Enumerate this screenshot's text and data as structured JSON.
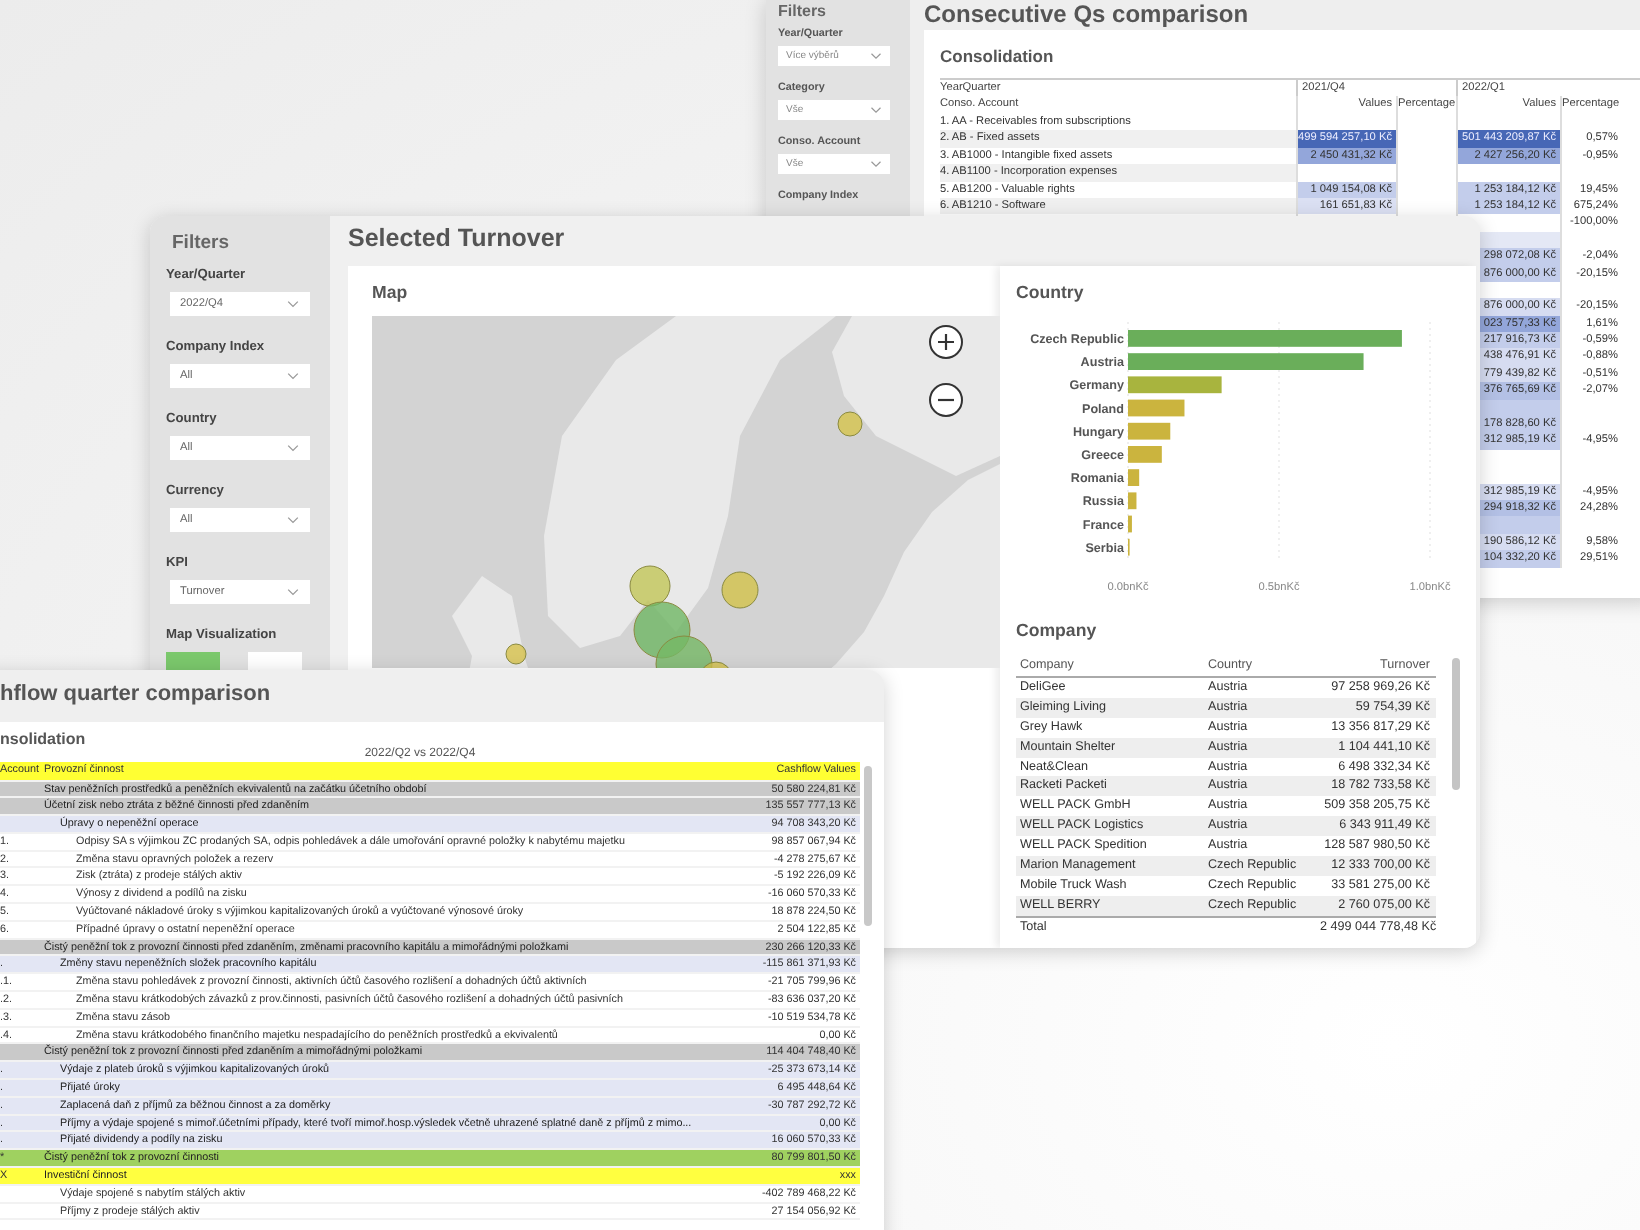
{
  "comparison_window": {
    "filters_title": "Filters",
    "filters": [
      {
        "label": "Year/Quarter",
        "value": "Více výběrů"
      },
      {
        "label": "Category",
        "value": "Vše"
      },
      {
        "label": "Conso. Account",
        "value": "Vše"
      },
      {
        "label": "Company Index"
      }
    ],
    "title": "Consecutive Qs comparison",
    "card_title": "Consolidation",
    "table": {
      "row_header": "YearQuarter",
      "account_header": "Conso. Account",
      "quarters": [
        {
          "label": "2021/Q4",
          "values": "Values",
          "percentage": "Percentage"
        },
        {
          "label": "2022/Q1",
          "values": "Values",
          "percentage": "Percentage"
        }
      ],
      "rows": [
        {
          "account": "1. AA - Receivables from subscriptions"
        },
        {
          "account": "2. AB - Fixed assets",
          "q1": {
            "value": "499 594 257,10 Kč",
            "color": "#4767b6"
          },
          "q2": {
            "value": "501 443 209,87 Kč",
            "color": "#4767b6",
            "percentage": "0,57%"
          }
        },
        {
          "account": "3. AB1000 - Intangible fixed assets",
          "q1": {
            "value": "2 450 431,32 Kč",
            "color": "#93a6da"
          },
          "q2": {
            "value": "2 427 256,20 Kč",
            "color": "#93a6da",
            "percentage": "-0,95%"
          }
        },
        {
          "account": "4. AB1100 - Incorporation expenses"
        },
        {
          "account": "5. AB1200 - Valuable rights",
          "q1": {
            "value": "1 049 154,08 Kč",
            "color": "#c3cdeb"
          },
          "q2": {
            "value": "1 253 184,12 Kč",
            "color": "#c3cdeb",
            "percentage": "19,45%"
          }
        },
        {
          "account": "6. AB1210 - Software",
          "q1": {
            "value": "161 651,83 Kč",
            "color": "#dbe0f3"
          },
          "q2": {
            "value": "1 253 184,12 Kč",
            "color": "#c3cdeb",
            "percentage": "675,24%"
          }
        },
        {
          "q2": {
            "percentage": "-100,00%"
          }
        },
        {
          "q2": {
            "color": "#e4e8f5"
          }
        },
        {
          "q2": {
            "value": "298 072,08 Kč",
            "color": "#c3cdeb",
            "percentage": "-2,04%"
          }
        },
        {
          "q2": {
            "value": "876 000,00 Kč",
            "color": "#c3cdeb",
            "percentage": "-20,15%"
          }
        },
        {
          "q2": {
            "color": "#ffffff"
          }
        },
        {
          "q2": {
            "value": "876 000,00 Kč",
            "color": "#d6dcf1",
            "percentage": "-20,15%"
          }
        },
        {
          "q2": {
            "value": "023 757,33 Kč",
            "color": "#93a6da",
            "percentage": "1,61%"
          }
        },
        {
          "q2": {
            "value": "217 916,73 Kč",
            "color": "#c3cdeb",
            "percentage": "-0,59%"
          }
        },
        {
          "q2": {
            "value": "438 476,91 Kč",
            "color": "#d6dcf1",
            "percentage": "-0,88%"
          }
        },
        {
          "q2": {
            "value": "779 439,82 Kč",
            "color": "#d6dcf1",
            "percentage": "-0,51%"
          }
        },
        {
          "q2": {
            "value": "376 765,69 Kč",
            "color": "#b3c0e5",
            "percentage": "-2,07%"
          }
        },
        {
          "q2": {
            "color": "#c3cdeb"
          }
        },
        {
          "q2": {
            "value": "178 828,60 Kč",
            "color": "#c3cdeb"
          }
        },
        {
          "q2": {
            "value": "312 985,19 Kč",
            "color": "#c3cdeb",
            "percentage": "-4,95%"
          }
        },
        {
          "q2": {
            "color": "#ffffff"
          }
        },
        {
          "q2": {
            "color": "#ffffff"
          }
        },
        {
          "q2": {
            "value": "312 985,19 Kč",
            "color": "#d6dcf1",
            "percentage": "-4,95%"
          }
        },
        {
          "q2": {
            "value": "294 918,32 Kč",
            "color": "#b3c0e5",
            "percentage": "24,28%"
          }
        },
        {
          "q2": {
            "color": "#c3cdeb"
          }
        },
        {
          "q2": {
            "value": "190 586,12 Kč",
            "color": "#d6dcf1",
            "percentage": "9,58%"
          }
        },
        {
          "q2": {
            "value": "104 332,20 Kč",
            "color": "#c3cdeb",
            "percentage": "29,51%"
          }
        }
      ]
    }
  },
  "turnover_window": {
    "filters_title": "Filters",
    "filters": [
      {
        "label": "Year/Quarter",
        "value": "2022/Q4"
      },
      {
        "label": "Company Index",
        "value": "All"
      },
      {
        "label": "Country",
        "value": "All"
      },
      {
        "label": "Currency",
        "value": "All"
      },
      {
        "label": "KPI",
        "value": "Turnover"
      }
    ],
    "map_visualization": {
      "label": "Map Visualization",
      "options": [
        {
          "selected": true
        },
        {
          "selected": false
        }
      ]
    },
    "title": "Selected Turnover",
    "map_title": "Map",
    "country": {
      "title": "Country",
      "chart_data": {
        "type": "bar",
        "orientation": "horizontal",
        "categories": [
          "Czech Republic",
          "Austria",
          "Germany",
          "Poland",
          "Hungary",
          "Greece",
          "Romania",
          "Russia",
          "France",
          "Serbia"
        ],
        "series": [
          {
            "values": [
              0.907,
              0.78,
              0.31,
              0.187,
              0.14,
              0.112,
              0.037,
              0.028,
              0.013,
              0.005
            ]
          }
        ],
        "xlim": [
          0,
          1
        ],
        "xticks": [
          {
            "value": 0,
            "label": "0.0bnKč"
          },
          {
            "value": 0.5,
            "label": "0.5bnKč"
          },
          {
            "value": 1,
            "label": "1.0bnKč"
          }
        ]
      }
    },
    "company": {
      "title": "Company",
      "columns": [
        "Company",
        "Country",
        "Turnover"
      ],
      "rows": [
        [
          "DeliGee",
          "Austria",
          "97 258 969,26 Kč"
        ],
        [
          "Gleiming Living",
          "Austria",
          "59 754,39 Kč"
        ],
        [
          "Grey Hawk",
          "Austria",
          "13 356 817,29 Kč"
        ],
        [
          "Mountain Shelter",
          "Austria",
          "1 104 441,10 Kč"
        ],
        [
          "Neat&Clean",
          "Austria",
          "6 498 332,34 Kč"
        ],
        [
          "Racketi Packeti",
          "Austria",
          "18 782 733,58 Kč"
        ],
        [
          "WELL PACK GmbH",
          "Austria",
          "509 358 205,75 Kč"
        ],
        [
          "WELL PACK Logistics",
          "Austria",
          "6 343 911,49 Kč"
        ],
        [
          "WELL PACK Spedition",
          "Austria",
          "128 587 980,50 Kč"
        ],
        [
          "Marion Management",
          "Czech Republic",
          "12 333 700,00 Kč"
        ],
        [
          "Mobile Truck Wash",
          "Czech Republic",
          "33 581 275,00 Kč"
        ],
        [
          "WELL BERRY",
          "Czech Republic",
          "2 760 075,00 Kč"
        ]
      ],
      "total": [
        "Total",
        "2 499 044 778,48 Kč"
      ]
    }
  },
  "cashflow_window": {
    "title": "hflow quarter comparison",
    "card_title": "nsolidation",
    "subtitle": "2022/Q2 vs 2022/Q4",
    "columns": [
      "Account",
      "Provozní činnost",
      "Cashflow Values"
    ],
    "rows": [
      {
        "kind": "total",
        "label": "Stav peněžních prostředků a peněžních ekvivalentů na začátku účetního období",
        "value": "50 580 224,81 Kč"
      },
      {
        "kind": "total",
        "label": "Účetní zisk nebo ztráta z běžné činnosti před zdaněním",
        "value": "135 557 777,13 Kč",
        "children": [
          {
            "kind": "group",
            "label": "Úpravy o nepeněžní operace",
            "value": "94 708 343,20 Kč",
            "children": [
              {
                "kind": "item",
                "code": "1.",
                "label": "Odpisy SA s výjimkou ZC prodaných SA, odpis pohledávek a dále umořování opravné položky k nabytému majetku",
                "value": "98 857 067,94 Kč"
              },
              {
                "kind": "item",
                "code": "2.",
                "label": "Změna stavu opravných položek a rezerv",
                "value": "-4 278 275,67 Kč"
              },
              {
                "kind": "item",
                "code": "3.",
                "label": "Zisk (ztráta) z prodeje stálých aktiv",
                "value": "-5 192 226,09 Kč"
              },
              {
                "kind": "item",
                "code": "4.",
                "label": "Výnosy z dividend a podílů na zisku",
                "value": "-16 060 570,33 Kč"
              },
              {
                "kind": "item",
                "code": "5.",
                "label": "Vyúčtované nákladové úroky s výjimkou kapitalizovaných úroků a vyúčtované výnosové úroky",
                "value": "18 878 224,50 Kč"
              },
              {
                "kind": "item",
                "code": "6.",
                "label": "Případné úpravy o ostatní nepeněžní operace",
                "value": "2 504 122,85 Kč"
              }
            ]
          }
        ]
      },
      {
        "kind": "total",
        "label": "Čistý peněžní tok z provozní činnosti před zdaněním, změnami pracovního kapitálu a mimořádnými položkami",
        "value": "230 266 120,33 Kč",
        "children": [
          {
            "kind": "group",
            "code": ".",
            "label": "Změny stavu nepeněžních složek pracovního kapitálu",
            "value": "-115 861 371,93 Kč",
            "children": [
              {
                "kind": "item",
                "code": ".1.",
                "label": "Změna stavu pohledávek z provozní činnosti, aktivních účtů časového rozlišení a dohadných účtů aktivních",
                "value": "-21 705 799,96 Kč"
              },
              {
                "kind": "item",
                "code": ".2.",
                "label": "Změna stavu krátkodobých závazků z prov.činnosti, pasivních účtů časového rozlišení a dohadných účtů pasivních",
                "value": "-83 636 037,20 Kč"
              },
              {
                "kind": "item",
                "code": ".3.",
                "label": "Změna stavu zásob",
                "value": "-10 519 534,78 Kč"
              },
              {
                "kind": "item",
                "code": ".4.",
                "label": "Změna stavu krátkodobého finančního majetku nespadajícího do peněžních prostředků a ekvivalentů",
                "value": "0,00 Kč"
              }
            ]
          }
        ]
      },
      {
        "kind": "total",
        "label": "Čistý peněžní tok z provozní činnosti před zdaněním a mimořádnými položkami",
        "value": "114 404 748,40 Kč",
        "children": [
          {
            "kind": "group",
            "code": ".",
            "label": "Výdaje z plateb úroků s výjimkou kapitalizovaných úroků",
            "value": "-25 373 673,14 Kč"
          },
          {
            "kind": "group",
            "code": ".",
            "label": "Přijaté úroky",
            "value": "6 495 448,64 Kč"
          },
          {
            "kind": "group",
            "code": ".",
            "label": "Zaplacená daň z příjmů za běžnou činnost a za doměrky",
            "value": "-30 787 292,72 Kč"
          },
          {
            "kind": "group",
            "code": ".",
            "label": "Příjmy a výdaje spojené s mimoř.účetními případy, které tvoří mimoř.hosp.výsledek včetně uhrazené splatné daně z příjmů z mimo...",
            "value": "0,00 Kč"
          },
          {
            "kind": "group",
            "code": ".",
            "label": "Přijaté dividendy a podíly na zisku",
            "value": "16 060 570,33 Kč"
          }
        ]
      },
      {
        "kind": "sum",
        "code": "*",
        "label": "Čistý peněžní tok z provozní činnosti",
        "value": "80 799 801,50 Kč"
      },
      {
        "kind": "section",
        "code": "X",
        "label": "Investiční činnost",
        "value": "xxx",
        "children": [
          {
            "kind": "item",
            "label": "Výdaje spojené s nabytím stálých aktiv",
            "value": "-402 789 468,22 Kč"
          },
          {
            "kind": "item",
            "label": "Příjmy z prodeje stálých aktiv",
            "value": "27 154 056,92 Kč"
          }
        ]
      }
    ]
  }
}
